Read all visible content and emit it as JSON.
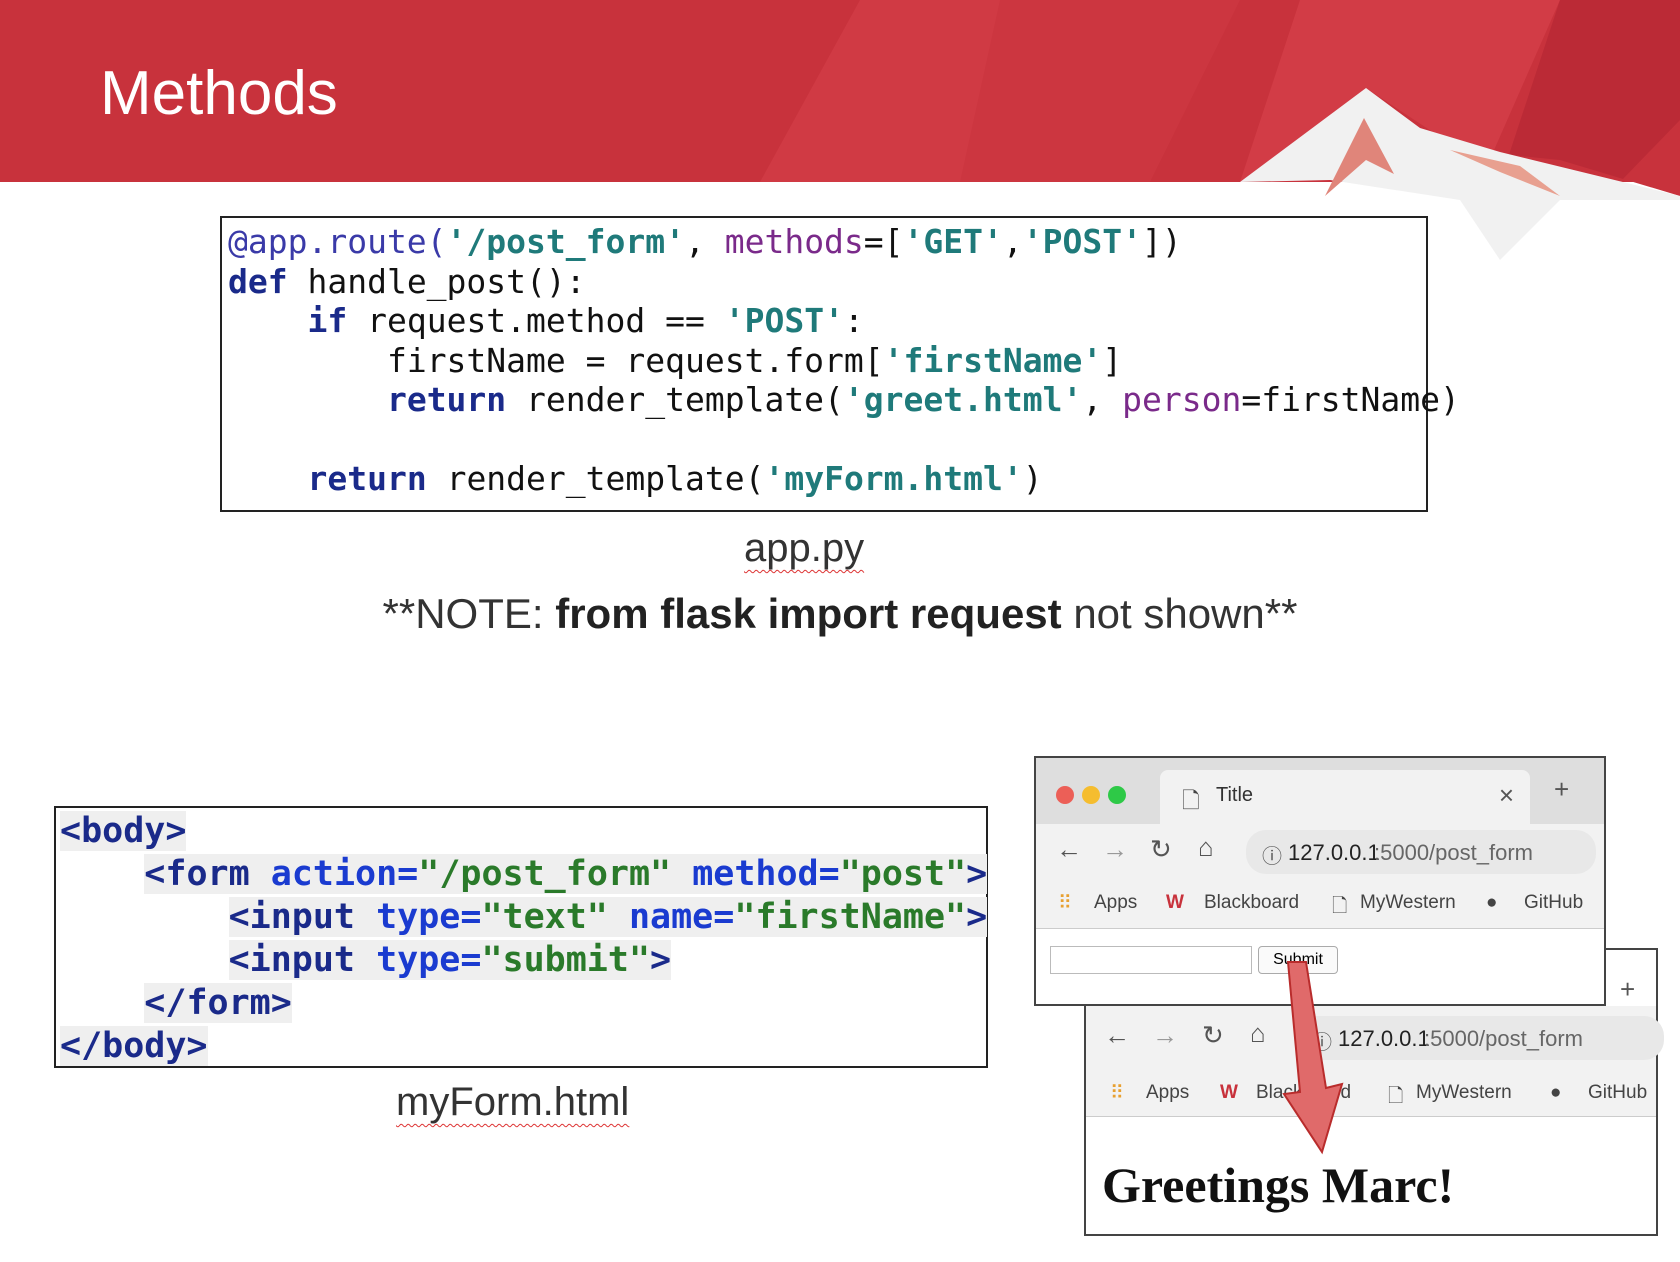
{
  "slide": {
    "title": "Methods"
  },
  "app_py": {
    "caption": "app.py",
    "lines": {
      "l1": {
        "a": "@app.route(",
        "b": "'/post_form'",
        "c": ", ",
        "d": "methods",
        "e": "=[",
        "f": "'GET'",
        "g": ",",
        "h": "'POST'",
        "i": "])"
      },
      "l2": {
        "a": "def",
        "b": " handle_post():"
      },
      "l3": {
        "a": "if",
        "b": " request.method == ",
        "c": "'POST'",
        "d": ":"
      },
      "l4": {
        "a": "firstName = request.form[",
        "b": "'firstName'",
        "c": "]"
      },
      "l5": {
        "a": "return",
        "b": " render_template(",
        "c": "'greet.html'",
        "d": ", ",
        "e": "person",
        "f": "=firstName)"
      },
      "l6": {
        "a": "return",
        "b": " render_template(",
        "c": "'myForm.html'",
        "d": ")"
      }
    }
  },
  "note": {
    "prefix": "**NOTE: ",
    "bold": "from flask import request",
    "suffix": " not shown**"
  },
  "my_form": {
    "caption": "myForm.html",
    "lines": {
      "l1": "<body>",
      "l2": {
        "a": "<form ",
        "b": "action=",
        "c": "\"/post_form\"",
        "d": " ",
        "e": "method=",
        "f": "\"post\"",
        "g": ">"
      },
      "l3": {
        "a": "<input ",
        "b": "type=",
        "c": "\"text\"",
        "d": " ",
        "e": "name=",
        "f": "\"firstName\"",
        "g": ">"
      },
      "l4": {
        "a": "<input ",
        "b": "type=",
        "c": "\"submit\"",
        "d": ">"
      },
      "l5": "</form>",
      "l6": "</body>"
    }
  },
  "browser_form": {
    "tab_title": "Title",
    "tab_close": "×",
    "new_tab": "+",
    "url_host": "127.0.0.1",
    "url_path": ":5000/post_form",
    "bookmarks": [
      "Apps",
      "Blackboard",
      "MyWestern",
      "GitHub"
    ],
    "submit_label": "Submit"
  },
  "browser_result": {
    "new_tab": "+",
    "url_host": "127.0.0.1",
    "url_path": ":5000/post_form",
    "bookmarks": [
      "Apps",
      "Blackboard",
      "MyWestern",
      "GitHub"
    ],
    "greeting": "Greetings Marc!"
  },
  "colors": {
    "banner": "#c8323c",
    "arrow": "#e06a6a"
  }
}
